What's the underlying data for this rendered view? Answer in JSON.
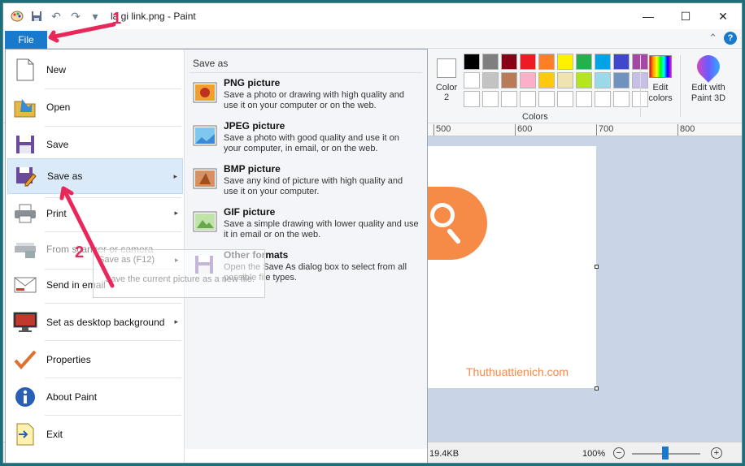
{
  "window": {
    "title": "la gi link.png - Paint"
  },
  "window_controls": {
    "minimize": "—",
    "maximize": "☐",
    "close": "✕"
  },
  "quick_access": {
    "undo_glyph": "↶",
    "redo_glyph": "↷",
    "customize_glyph": "▾"
  },
  "tabs": {
    "file_label": "File",
    "collapse_glyph": "⌃",
    "help_glyph": "?"
  },
  "ribbon": {
    "color2_label": "Color 2",
    "colors_label": "Colors",
    "edit_colors_label": "Edit colors",
    "edit_paint3d_label": "Edit with Paint 3D",
    "palette_row1": [
      "#000000",
      "#7f7f7f",
      "#880015",
      "#ed1c24",
      "#ff7f27",
      "#fff200",
      "#22b14c",
      "#00a2e8",
      "#3f48cc",
      "#a349a4"
    ],
    "palette_row2": [
      "#ffffff",
      "#c3c3c3",
      "#b97a57",
      "#ffaec9",
      "#ffc90e",
      "#efe4b0",
      "#b5e61d",
      "#99d9ea",
      "#7092be",
      "#c8bfe7"
    ]
  },
  "ruler": {
    "ticks": [
      "500",
      "600",
      "700",
      "800"
    ]
  },
  "canvas": {
    "site_text": "Thuthuattienich.com"
  },
  "status": {
    "size": "19.4KB",
    "zoom": "100%",
    "zoom_out": "−",
    "zoom_in": "+"
  },
  "file_menu": {
    "items": [
      {
        "label": "New"
      },
      {
        "label": "Open"
      },
      {
        "label": "Save"
      },
      {
        "label": "Save as"
      },
      {
        "label": "Print"
      },
      {
        "label": "From scanner or camera"
      },
      {
        "label": "Send in email"
      },
      {
        "label": "Set as desktop background"
      },
      {
        "label": "Properties"
      },
      {
        "label": "About Paint"
      },
      {
        "label": "Exit"
      }
    ],
    "submenu_chevron": "▸"
  },
  "save_as_panel": {
    "title": "Save as",
    "options": [
      {
        "title": "PNG picture",
        "desc": "Save a photo or drawing with high quality and use it on your computer or on the web."
      },
      {
        "title": "JPEG picture",
        "desc": "Save a photo with good quality and use it on your computer, in email, or on the web."
      },
      {
        "title": "BMP picture",
        "desc": "Save any kind of picture with high quality and use it on your computer."
      },
      {
        "title": "GIF picture",
        "desc": "Save a simple drawing with lower quality and use it in email or on the web."
      },
      {
        "title": "Other formats",
        "desc": "Open the Save As dialog box to select from all possible file types."
      }
    ]
  },
  "tooltip": {
    "title": "Save as (F12)",
    "chevron": "▸",
    "text": "Save the current picture as a new file."
  },
  "annotations": {
    "step1": "1",
    "step2": "2",
    "color": "#e8285a"
  }
}
